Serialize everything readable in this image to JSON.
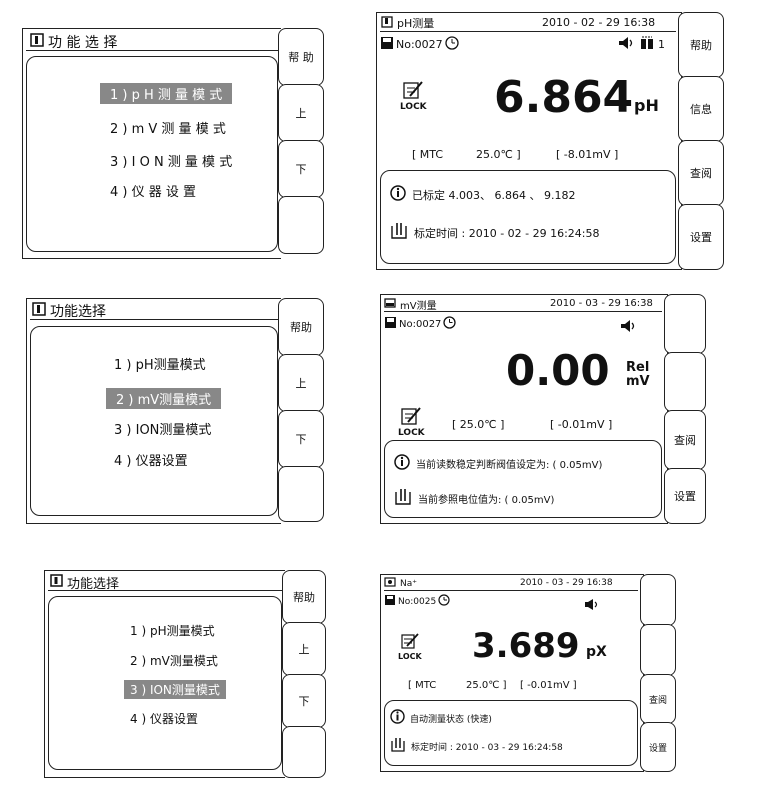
{
  "menu_screens": [
    {
      "title": "功 能 选 择",
      "items": [
        "1 ) p H 测 量 模 式",
        "2 ) m V 测 量 模 式",
        "3 ) I O N 测 量 模 式",
        "4 ) 仪 器 设 置"
      ],
      "selected_index": 0,
      "side_buttons": [
        "帮 助",
        "上",
        "下",
        ""
      ]
    },
    {
      "title": "功能选择",
      "items": [
        "1 ) pH测量模式",
        "2 ) mV测量模式",
        "3 ) ION测量模式",
        "4 ) 仪器设置"
      ],
      "selected_index": 1,
      "side_buttons": [
        "帮助",
        "上",
        "下",
        ""
      ]
    },
    {
      "title": "功能选择",
      "items": [
        "1 ) pH测量模式",
        "2 ) mV测量模式",
        "3 ) ION测量模式",
        "4 ) 仪器设置"
      ],
      "selected_index": 2,
      "side_buttons": [
        "帮助",
        "上",
        "下",
        ""
      ]
    }
  ],
  "measure_screens": [
    {
      "mode": "pH测量",
      "datetime": "2010 - 02 - 29    16:38",
      "number": "No:0027",
      "channel": "1",
      "value": "6.864",
      "unit": "pH",
      "lock": "LOCK",
      "temp_mode": "[   MTC",
      "temp": "25.0℃ ]",
      "mv": "[          -8.01mV  ]",
      "info1": "已标定  4.003、 6.864 、 9.182",
      "info2": "标定时间 : 2010 - 02 - 29    16:24:58",
      "side_buttons": [
        "帮助",
        "信息",
        "查阅",
        "设置"
      ]
    },
    {
      "mode": "mV测量",
      "datetime": "2010 - 03 - 29    16:38",
      "number": "No:0027",
      "value": "0.00",
      "unit_line1": "Rel",
      "unit_line2": "mV",
      "lock": "LOCK",
      "temp": "[      25.0℃ ]",
      "mv": "[         -0.01mV  ]",
      "info1": "当前读数稳定判断阀值设定为: (  0.05mV)",
      "info2": "当前参照电位值为: (  0.05mV)",
      "side_buttons": [
        "",
        "",
        "查阅",
        "设置"
      ]
    },
    {
      "mode": "Na⁺",
      "datetime": "2010 - 03 - 29    16:38",
      "number": "No:0025",
      "value": "3.689",
      "unit": "pX",
      "lock": "LOCK",
      "temp_mode": "[   MTC",
      "temp": "25.0℃ ]",
      "mv": "[          -0.01mV  ]",
      "info1": "自动测量状态 (快速)",
      "info2": "标定时间 : 2010 - 03 - 29    16:24:58",
      "side_buttons": [
        "",
        "",
        "查阅",
        "设置"
      ]
    }
  ]
}
